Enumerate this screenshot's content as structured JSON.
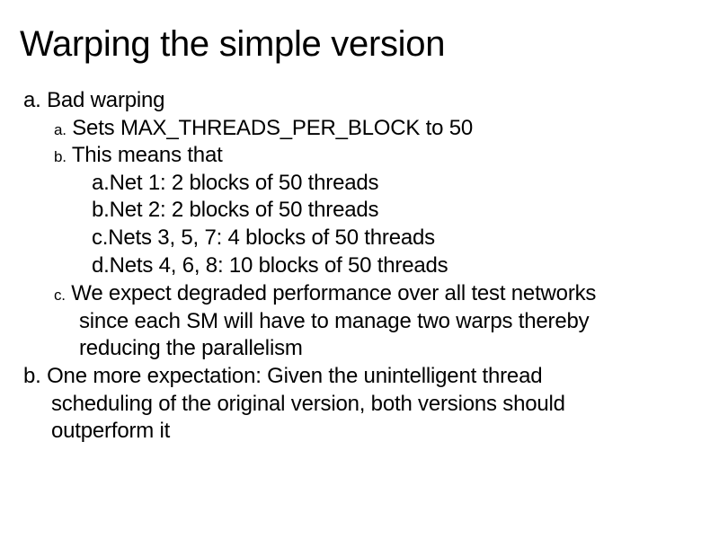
{
  "slide": {
    "title": "Warping the simple version",
    "items": [
      {
        "marker": "a.",
        "text": "Bad warping",
        "subitems": [
          {
            "marker": "a.",
            "text": "Sets MAX_THREADS_PER_BLOCK to 50"
          },
          {
            "marker": "b.",
            "text": "This means that",
            "subitems": [
              {
                "marker": "a.",
                "text": "Net 1:  2 blocks of 50 threads"
              },
              {
                "marker": "b.",
                "text": "Net 2:  2 blocks of 50 threads"
              },
              {
                "marker": "c.",
                "text": "Nets 3, 5, 7:  4 blocks of 50 threads"
              },
              {
                "marker": "d.",
                "text": "Nets 4, 6, 8:  10 blocks of 50 threads"
              }
            ]
          },
          {
            "marker": "c.",
            "lines": [
              "We expect degraded performance over all test networks",
              "since each SM will have to manage two warps thereby",
              "reducing the parallelism"
            ]
          }
        ]
      },
      {
        "marker": "b.",
        "lines": [
          "One more expectation:  Given the unintelligent thread",
          "scheduling of the original version, both versions should",
          "outperform it"
        ]
      }
    ]
  }
}
